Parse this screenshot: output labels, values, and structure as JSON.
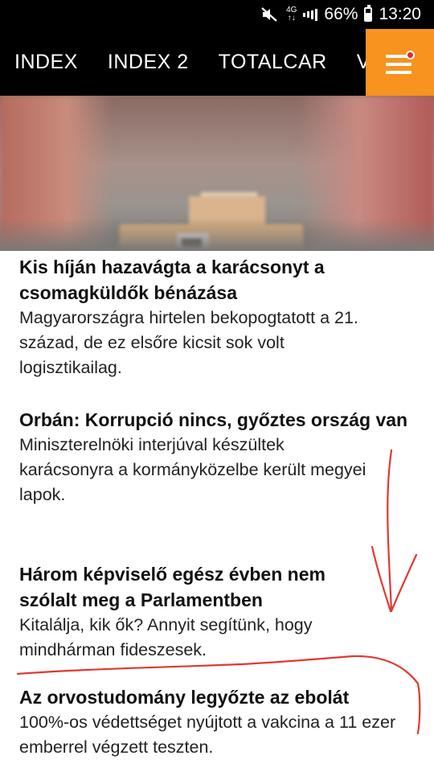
{
  "status_bar": {
    "mute_icon": "mute-icon",
    "network_top": "4G",
    "network_bottom": "↑↓",
    "battery": "66%",
    "time": "13:20"
  },
  "nav": {
    "tabs": [
      {
        "label": "INDEX"
      },
      {
        "label": "INDEX 2"
      },
      {
        "label": "TOTALCAR"
      },
      {
        "label": "V"
      }
    ],
    "menu_icon": "hamburger-menu-icon",
    "accent_color": "#f7931e",
    "notification_color": "#e8262c"
  },
  "hero": {
    "image": "blurred cardboard packages on a conveyor belt"
  },
  "articles": [
    {
      "title": "Kis híján hazavágta a karácsonyt a csomagküldők bénázása",
      "lead": "Magyarországra hirtelen bekopogtatott a 21. század, de ez elsőre kicsit sok volt logisztikailag."
    },
    {
      "title": "Orbán: Korrupció nincs, győztes ország van",
      "lead": "Miniszterelnöki interjúval készültek karácsonyra a kormányközelbe került megyei lapok."
    },
    {
      "title": "Három képviselő egész évben nem szólalt meg a Parlamentben",
      "lead": "Kitalálja, kik ők? Annyit segítünk, hogy mindhárman fideszesek."
    },
    {
      "title": "Az orvostudomány legyőzte az ebolát",
      "lead": "100%-os védettséget nyújtott a vakcina a 11 ezer emberrel végzett teszten."
    }
  ],
  "annotation_color": "#e0392f"
}
